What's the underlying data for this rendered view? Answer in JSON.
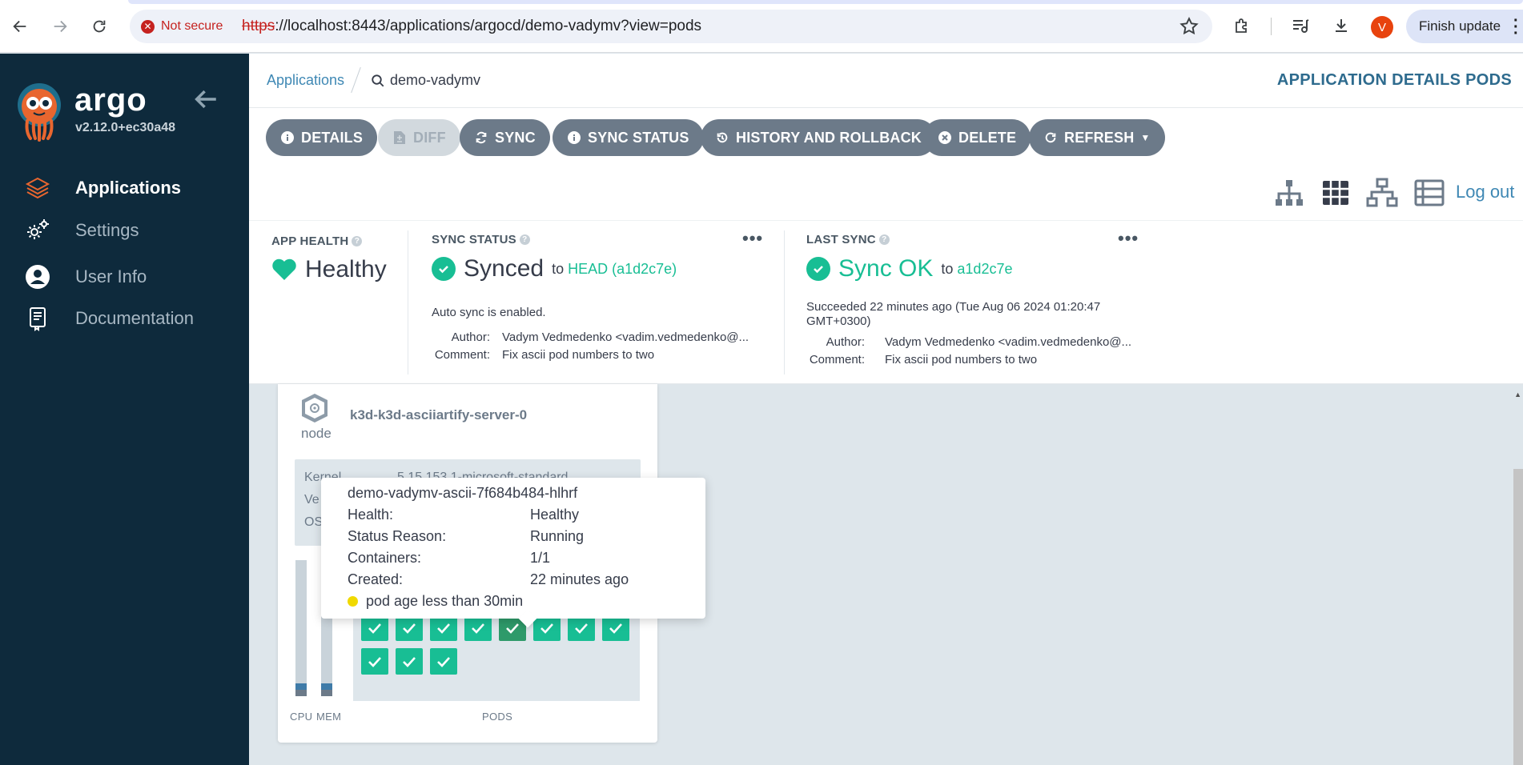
{
  "browser": {
    "security_label": "Not secure",
    "url_scheme": "https",
    "url_rest": "://localhost:8443/applications/argocd/demo-vadymv?view=pods",
    "profile_initial": "V",
    "finish_update_label": "Finish update"
  },
  "sidebar": {
    "brand": "argo",
    "version": "v2.12.0+ec30a48",
    "items": [
      {
        "label": "Applications",
        "icon": "layers-icon",
        "active": true
      },
      {
        "label": "Settings",
        "icon": "gears-icon",
        "active": false
      },
      {
        "label": "User Info",
        "icon": "user-circle-icon",
        "active": false
      },
      {
        "label": "Documentation",
        "icon": "book-icon",
        "active": false
      }
    ]
  },
  "topbar": {
    "breadcrumb_root": "Applications",
    "breadcrumb_current": "demo-vadymv",
    "page_title": "APPLICATION DETAILS PODS"
  },
  "toolbar": {
    "buttons": [
      {
        "label": "DETAILS",
        "icon": "info-icon"
      },
      {
        "label": "DIFF",
        "icon": "file-diff-icon",
        "disabled": true
      },
      {
        "label": "SYNC",
        "icon": "sync-icon"
      },
      {
        "label": "SYNC STATUS",
        "icon": "info-icon"
      },
      {
        "label": "HISTORY AND ROLLBACK",
        "icon": "history-icon"
      },
      {
        "label": "DELETE",
        "icon": "close-circle-icon"
      },
      {
        "label": "REFRESH",
        "icon": "redo-icon"
      }
    ],
    "view_icons": [
      "tree-view-icon",
      "pods-view-icon",
      "network-view-icon",
      "list-view-icon"
    ],
    "active_view": "pods-view-icon",
    "logout_label": "Log out"
  },
  "status": {
    "app_health": {
      "label": "APP HEALTH",
      "value": "Healthy"
    },
    "sync_status": {
      "label": "SYNC STATUS",
      "value": "Synced",
      "to_text": "to",
      "revision": "HEAD (a1d2c7e)",
      "auto_sync": "Auto sync is enabled.",
      "author_key": "Author:",
      "author": "Vadym Vedmedenko <vadim.vedmedenko@...",
      "comment_key": "Comment:",
      "comment": "Fix ascii pod numbers to two"
    },
    "last_sync": {
      "label": "LAST SYNC",
      "value": "Sync OK",
      "to_text": "to",
      "revision": "a1d2c7e",
      "succeeded_line1": "Succeeded 22 minutes ago (Tue Aug 06 2024 01:20:47",
      "succeeded_line2": "GMT+0300)",
      "author_key": "Author:",
      "author": "Vadym Vedmedenko <vadim.vedmedenko@...",
      "comment_key": "Comment:",
      "comment": "Fix ascii pod numbers to two"
    },
    "more_label": "•••"
  },
  "node": {
    "type_label": "node",
    "name": "k3d-k3d-asciiartify-server-0",
    "info_rows": [
      {
        "key": "Kernel",
        "value": "5.15.153.1-microsoft-standard"
      },
      {
        "key": "Ve",
        "value": ""
      },
      {
        "key": "OS",
        "value": ""
      }
    ],
    "cpu_label": "CPU",
    "mem_label": "MEM",
    "pods_label": "PODS",
    "pod_count": 11,
    "hovered_pod_index": 4
  },
  "tooltip": {
    "title": "demo-vadymv-ascii-7f684b484-hlhrf",
    "rows": [
      {
        "key": "Health:",
        "value": "Healthy"
      },
      {
        "key": "Status Reason:",
        "value": "Running"
      },
      {
        "key": "Containers:",
        "value": "1/1"
      },
      {
        "key": "Created:",
        "value": "22 minutes ago"
      }
    ],
    "age_note": "pod age less than 30min"
  },
  "colors": {
    "sidebar_bg": "#0e2a3c",
    "accent_green": "#18be94",
    "button_gray": "#6c7a89",
    "link_blue": "#3f88b4",
    "age_yellow": "#f0d900"
  }
}
